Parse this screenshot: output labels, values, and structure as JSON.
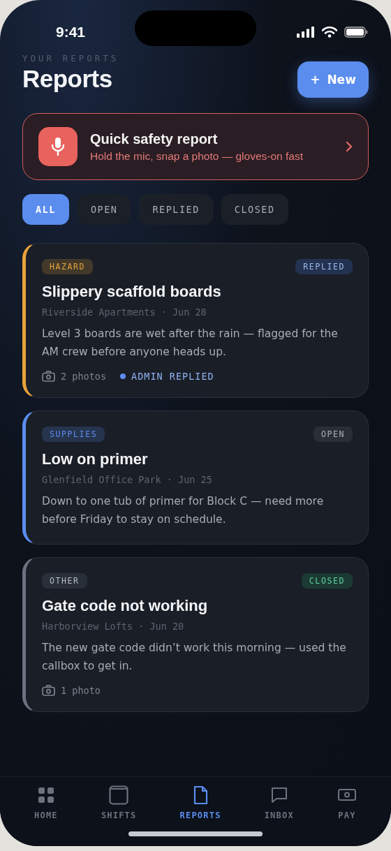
{
  "status_bar": {
    "time": "9:41"
  },
  "header": {
    "eyebrow": "YOUR REPORTS",
    "title": "Reports",
    "new_button": {
      "icon": "+",
      "label": "New"
    }
  },
  "quick_report": {
    "title": "Quick safety report",
    "subtitle": "Hold the mic, snap a photo — gloves-on fast"
  },
  "filters": [
    {
      "label": "ALL",
      "selected": true
    },
    {
      "label": "OPEN",
      "selected": false
    },
    {
      "label": "REPLIED",
      "selected": false
    },
    {
      "label": "CLOSED",
      "selected": false
    }
  ],
  "reports": [
    {
      "category": "HAZARD",
      "color": "#e8a33a",
      "status": "REPLIED",
      "kind": "replied",
      "title": "Slippery scaffold boards",
      "meta": "Riverside Apartments · Jun 28",
      "body": "Level 3 boards are wet after the rain — flagged for the AM crew before anyone heads up.",
      "photos": "2 photos",
      "reply": "ADMIN REPLIED"
    },
    {
      "category": "SUPPLIES",
      "color": "#5b8def",
      "status": "OPEN",
      "kind": "open",
      "title": "Low on primer",
      "meta": "Glenfield Office Park · Jun 25",
      "body": "Down to one tub of primer for Block C — need more before Friday to stay on schedule."
    },
    {
      "category": "OTHER",
      "color": "#6b7280",
      "status": "CLOSED",
      "kind": "closed",
      "title": "Gate code not working",
      "meta": "Harborview Lofts · Jun 20",
      "body": "The new gate code didn’t work this morning — used the callbox to get in.",
      "photos": "1 photo"
    }
  ],
  "tab_bar": [
    {
      "label": "HOME",
      "kind": "grid",
      "selected": false
    },
    {
      "label": "SHIFTS",
      "kind": "window",
      "selected": false
    },
    {
      "label": "REPORTS",
      "kind": "document",
      "selected": true
    },
    {
      "label": "INBOX",
      "kind": "chat",
      "selected": false
    },
    {
      "label": "PAY",
      "kind": "cash",
      "selected": false
    }
  ]
}
